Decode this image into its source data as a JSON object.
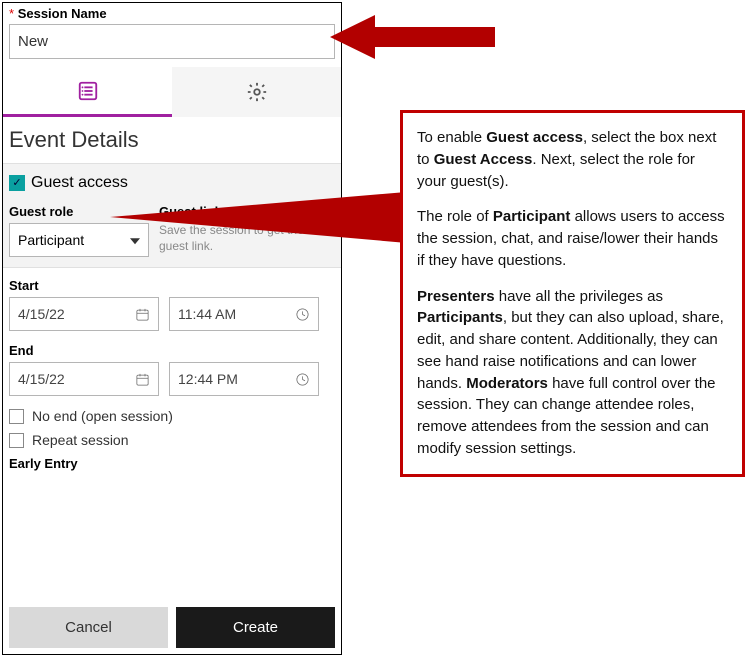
{
  "sessionName": {
    "label": "Session Name",
    "value": "New"
  },
  "sectionTitle": "Event Details",
  "guestAccess": {
    "label": "Guest access",
    "checked": true
  },
  "guestRole": {
    "label": "Guest role",
    "selected": "Participant"
  },
  "guestLink": {
    "label": "Guest link",
    "hint": "Save the session to get the guest link."
  },
  "start": {
    "label": "Start",
    "date": "4/15/22",
    "time": "11:44 AM"
  },
  "end": {
    "label": "End",
    "date": "4/15/22",
    "time": "12:44 PM"
  },
  "noEnd": {
    "label": "No end (open session)"
  },
  "repeat": {
    "label": "Repeat session"
  },
  "earlyEntry": {
    "label": "Early Entry"
  },
  "buttons": {
    "cancel": "Cancel",
    "create": "Create"
  },
  "callout": {
    "p1a": "To enable ",
    "p1b": "Guest access",
    "p1c": ", select the box next to ",
    "p1d": "Guest Access",
    "p1e": ". Next, select the role for your guest(s).",
    "p2a": "The role of ",
    "p2b": "Participant",
    "p2c": " allows users to access the session, chat, and raise/lower their hands if they have questions.",
    "p3a": "Presenters",
    "p3b": " have all the privileges as ",
    "p3c": "Participants",
    "p3d": ", but they can also upload, share, edit, and share content. Additionally, they can see hand raise notifications and can lower hands. ",
    "p3e": "Moderators",
    "p3f": " have full control over the session. They can change attendee roles, remove attendees from the session and can modify session settings."
  }
}
